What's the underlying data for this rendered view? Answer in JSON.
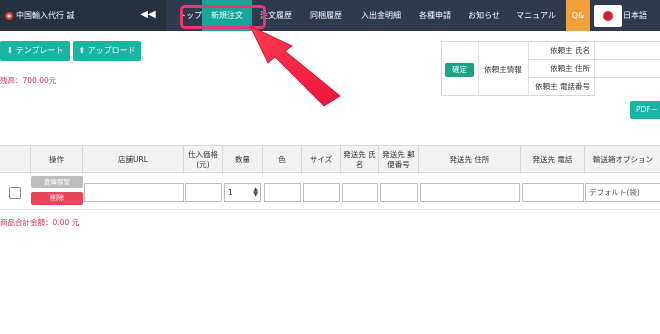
{
  "brand": {
    "title": "中国輸入代行 誠"
  },
  "nav": {
    "collapse_glyph": "◀◀",
    "items": [
      "トップ",
      "新規注文",
      "注文履歴",
      "同梱履歴",
      "入出金明細",
      "各種申請",
      "お知らせ",
      "マニュアル",
      "Q&"
    ],
    "active": "新規注文",
    "language": "日本語"
  },
  "toolbar": {
    "template_label": "テンプレート",
    "upload_label": "アップロード",
    "template_icon": "download-icon",
    "upload_icon": "upload-icon"
  },
  "balance": {
    "text": "残高：700.00元"
  },
  "client_info": {
    "confirm_label": "確定",
    "group_label": "依頼主情報",
    "rows": [
      "依頼主 氏名",
      "依頼主 住所",
      "依頼主 電話番号"
    ]
  },
  "pdf_label": "PDF－",
  "table": {
    "headers": [
      "操作",
      "店舗URL",
      "仕入価格(元)",
      "数量",
      "色",
      "サイズ",
      "発送先 氏名",
      "発送先 郵便番号",
      "発送先 住所",
      "発送先 電話",
      "輸送箱オプション"
    ],
    "row": {
      "stock_label": "倉庫保管",
      "delete_label": "削除",
      "quantity": "1",
      "shipping_box": "デフォルト(袋)"
    }
  },
  "total": {
    "text": "商品合計金額：0.00 元"
  },
  "colors": {
    "nav_bg": "#2f3a4f",
    "active_tab": "#17a79a",
    "accent_teal": "#19b4a4",
    "danger": "#e6475a",
    "annotation": "#e63a6f"
  }
}
